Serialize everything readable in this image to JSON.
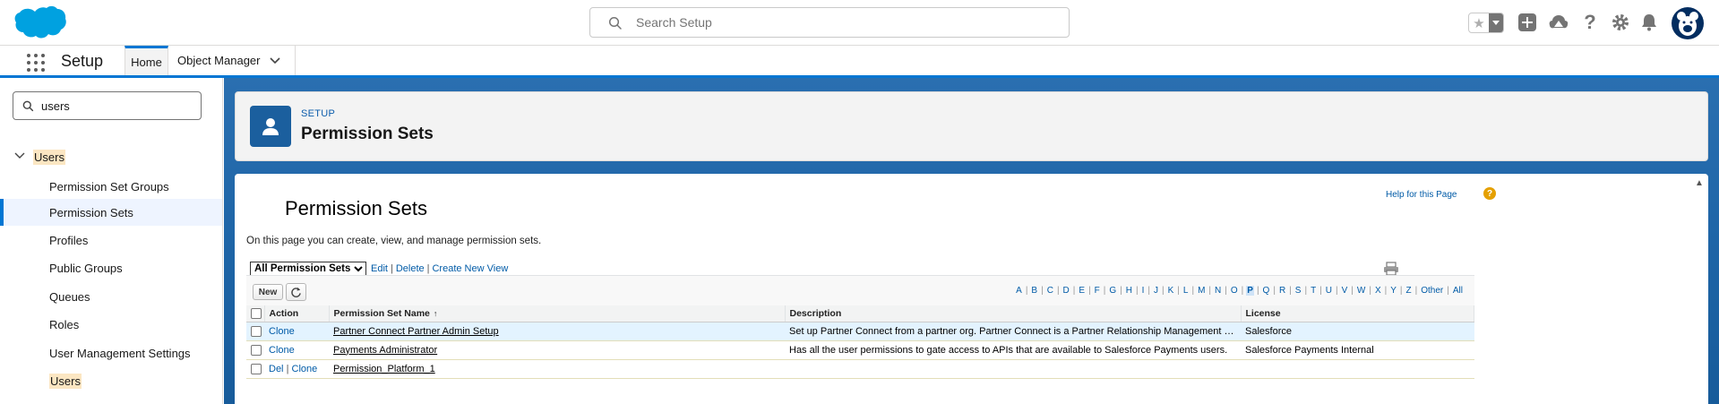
{
  "header": {
    "search_placeholder": "Search Setup",
    "icons": [
      "favorites-star-icon",
      "add-icon",
      "trailhead-icon",
      "help-icon",
      "gear-icon",
      "bell-icon",
      "avatar"
    ]
  },
  "context_bar": {
    "app_name": "Setup",
    "tabs": [
      {
        "label": "Home",
        "active": true
      },
      {
        "label": "Object Manager",
        "active": false
      }
    ]
  },
  "sidebar": {
    "quick_find_value": "users",
    "parent": {
      "label": "Users",
      "expanded": true
    },
    "items": [
      {
        "label": "Permission Set Groups",
        "active": false
      },
      {
        "label": "Permission Sets",
        "active": true
      },
      {
        "label": "Profiles",
        "active": false
      },
      {
        "label": "Public Groups",
        "active": false
      },
      {
        "label": "Queues",
        "active": false
      },
      {
        "label": "Roles",
        "active": false
      },
      {
        "label": "User Management Settings",
        "active": false
      },
      {
        "label": "Users",
        "active": false,
        "highlighted": true
      }
    ]
  },
  "page_header": {
    "eyebrow": "SETUP",
    "title": "Permission Sets"
  },
  "content": {
    "title": "Permission Sets",
    "help_link": "Help for this Page",
    "description": "On this page you can create, view, and manage permission sets.",
    "view_select": "All Permission Sets",
    "view_links": [
      "Edit",
      "Delete",
      "Create New View"
    ],
    "new_button": "New",
    "alphabet": [
      "A",
      "B",
      "C",
      "D",
      "E",
      "F",
      "G",
      "H",
      "I",
      "J",
      "K",
      "L",
      "M",
      "N",
      "O",
      "P",
      "Q",
      "R",
      "S",
      "T",
      "U",
      "V",
      "W",
      "X",
      "Y",
      "Z",
      "Other",
      "All"
    ],
    "alphabet_selected": "P",
    "columns": [
      "Action",
      "Permission Set Name",
      "Description",
      "License"
    ],
    "sort_column": "Permission Set Name",
    "rows": [
      {
        "action": [
          "Clone"
        ],
        "name": "Partner Connect Partner Admin Setup",
        "description": "Set up Partner Connect from a partner org. Partner Connect is a Partner Relationship Management solution that allows...",
        "license": "Salesforce"
      },
      {
        "action": [
          "Clone"
        ],
        "name": "Payments Administrator",
        "description": "Has all the user permissions to gate access to APIs that are available to Salesforce Payments users.",
        "license": "Salesforce Payments Internal"
      },
      {
        "action": [
          "Del",
          "Clone"
        ],
        "name": "Permission_Platform_1",
        "description": "",
        "license": ""
      }
    ]
  },
  "colors": {
    "brand_blue": "#0176d3",
    "link_blue": "#015ba7",
    "main_bg": "#1b5f9e",
    "highlight": "#fbe6c2"
  }
}
